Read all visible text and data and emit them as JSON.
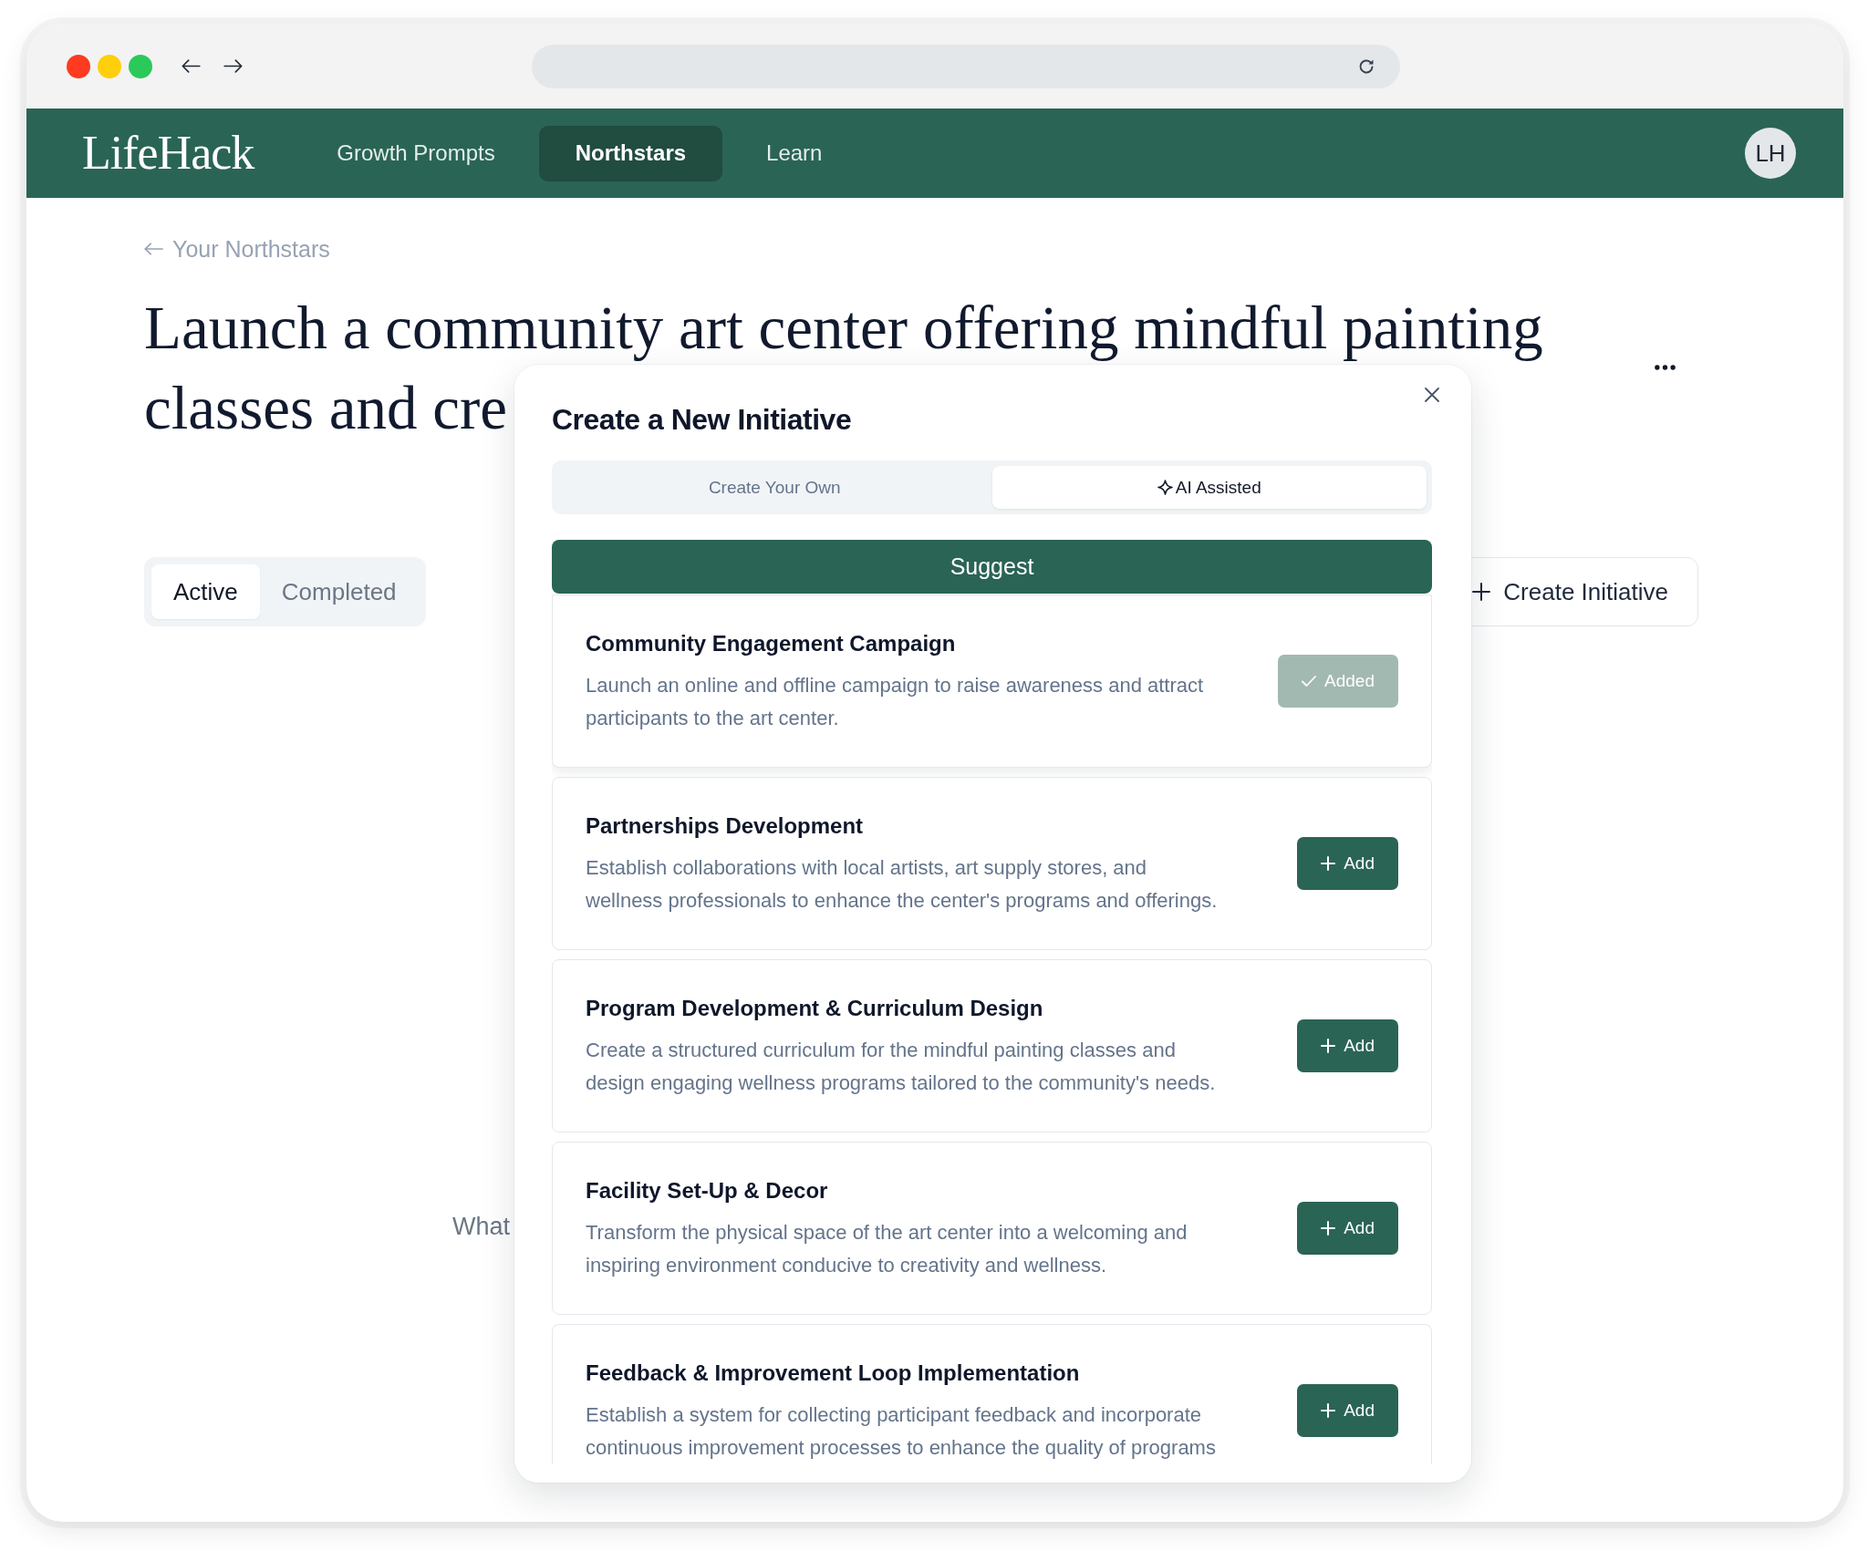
{
  "nav": {
    "logo": "LifeHack",
    "items": [
      {
        "label": "Growth Prompts",
        "selected": false
      },
      {
        "label": "Northstars",
        "selected": true
      },
      {
        "label": "Learn",
        "selected": false
      }
    ],
    "avatar": "LH"
  },
  "back_link": "Your Northstars",
  "title_lines": [
    "Launch a community art center offering mindful painting",
    "classes and cre"
  ],
  "view_tabs": [
    {
      "label": "Active",
      "selected": true
    },
    {
      "label": "Completed",
      "selected": false
    }
  ],
  "create_button": "Create Initiative",
  "empty_state": "What",
  "modal": {
    "title": "Create a New Initiative",
    "tabs": [
      {
        "label": "Create Your Own",
        "kind": "manual",
        "selected": false
      },
      {
        "label": "AI Assisted",
        "kind": "ai",
        "selected": true
      }
    ],
    "suggest_button": "Suggest",
    "suggestions": [
      {
        "title": "Community Engagement Campaign",
        "description": "Launch an online and offline campaign to raise awareness and attract participants to the art center.",
        "action": "Added",
        "added": true
      },
      {
        "title": "Partnerships Development",
        "description": "Establish collaborations with local artists, art supply stores, and wellness professionals to enhance the center's programs and offerings.",
        "action": "Add",
        "added": false
      },
      {
        "title": "Program Development & Curriculum Design",
        "description": "Create a structured curriculum for the mindful painting classes and design engaging wellness programs tailored to the community's needs.",
        "action": "Add",
        "added": false
      },
      {
        "title": "Facility Set-Up & Decor",
        "description": "Transform the physical space of the art center into a welcoming and inspiring environment conducive to creativity and wellness.",
        "action": "Add",
        "added": false
      },
      {
        "title": "Feedback & Improvement Loop Implementation",
        "description": "Establish a system for collecting participant feedback and incorporate continuous improvement processes to enhance the quality of programs",
        "action": "Add",
        "added": false
      }
    ]
  }
}
